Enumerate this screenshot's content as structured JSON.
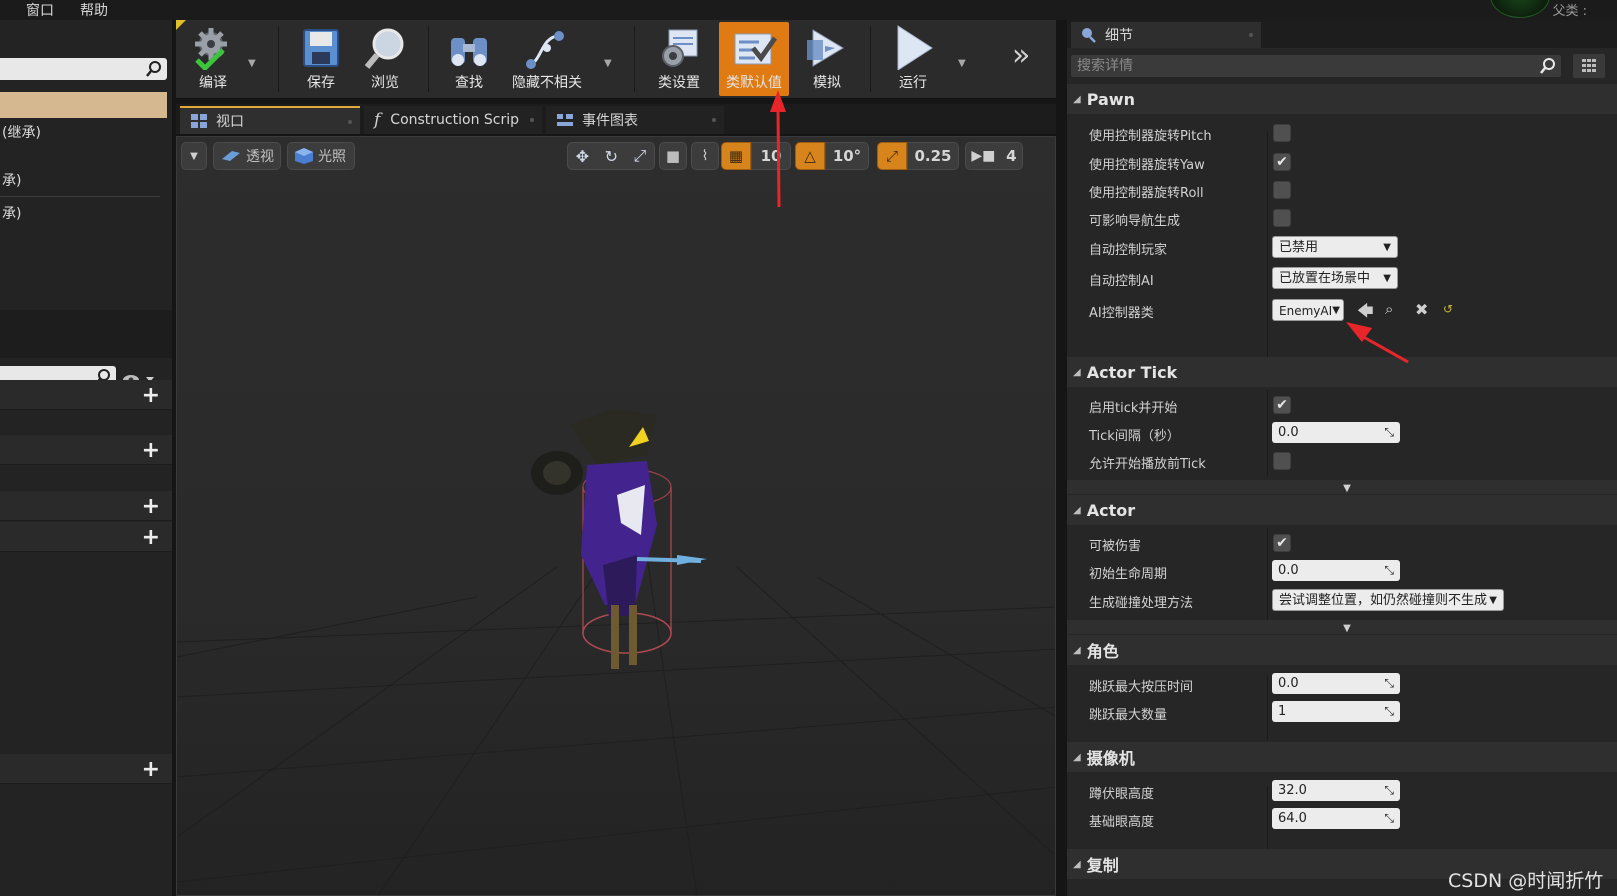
{
  "menubar": {
    "items": [
      "窗口",
      "帮助"
    ],
    "parent_class": "父类 :"
  },
  "left_panel": {
    "items": [
      "(继承)",
      "承)",
      "承)"
    ]
  },
  "toolbar": {
    "buttons": [
      {
        "label": "编译",
        "icon": "compile-gear-icon"
      },
      {
        "label": "保存",
        "icon": "save-disk-icon"
      },
      {
        "label": "浏览",
        "icon": "browse-magnifier-icon"
      },
      {
        "label": "查找",
        "icon": "find-binoculars-icon"
      },
      {
        "label": "隐藏不相关",
        "icon": "hide-unrelated-icon"
      },
      {
        "label": "类设置",
        "icon": "class-settings-icon"
      },
      {
        "label": "类默认值",
        "icon": "class-defaults-icon",
        "active": true
      },
      {
        "label": "模拟",
        "icon": "simulate-icon"
      },
      {
        "label": "运行",
        "icon": "play-icon"
      }
    ],
    "overflow": "»"
  },
  "tabs": [
    {
      "label": "视口",
      "icon": "viewport-grid-icon"
    },
    {
      "label": "Construction Scrip",
      "icon": "function-icon"
    },
    {
      "label": "事件图表",
      "icon": "event-graph-icon"
    }
  ],
  "viewport_toolbar": {
    "perspective": "透视",
    "lighting": "光照",
    "grid_snap": "10",
    "rotation_snap": "10°",
    "scale_snap": "0.25",
    "camera_speed": "4"
  },
  "details": {
    "tab_title": "细节",
    "search_placeholder": "搜索详情",
    "sections": {
      "pawn": {
        "title": "Pawn",
        "use_ctrl_pitch": "使用控制器旋转Pitch",
        "use_ctrl_yaw": "使用控制器旋转Yaw",
        "use_ctrl_roll": "使用控制器旋转Roll",
        "can_affect_nav": "可影响导航生成",
        "auto_possess_player": "自动控制玩家",
        "auto_possess_player_value": "已禁用",
        "auto_possess_ai": "自动控制AI",
        "auto_possess_ai_value": "已放置在场景中",
        "ai_controller_class": "AI控制器类",
        "ai_controller_class_value": "EnemyAI"
      },
      "actor_tick": {
        "title": "Actor Tick",
        "start_with_tick": "启用tick并开始",
        "tick_interval": "Tick间隔（秒）",
        "tick_interval_value": "0.0",
        "allow_tick_before_play": "允许开始播放前Tick"
      },
      "actor": {
        "title": "Actor",
        "can_be_damaged": "可被伤害",
        "initial_lifespan": "初始生命周期",
        "initial_lifespan_value": "0.0",
        "spawn_collision": "生成碰撞处理方法",
        "spawn_collision_value": "尝试调整位置，如仍然碰撞则不生成"
      },
      "character": {
        "title": "角色",
        "jump_max_hold": "跳跃最大按压时间",
        "jump_max_hold_value": "0.0",
        "jump_max_count": "跳跃最大数量",
        "jump_max_count_value": "1"
      },
      "camera": {
        "title": "摄像机",
        "crouched_eye": "蹲伏眼高度",
        "crouched_eye_value": "32.0",
        "base_eye": "基础眼高度",
        "base_eye_value": "64.0"
      },
      "replication": {
        "title": "复制"
      }
    }
  },
  "checkbox_states": {
    "use_ctrl_pitch": false,
    "use_ctrl_yaw": true,
    "use_ctrl_roll": false,
    "can_affect_nav": false,
    "start_with_tick": true,
    "allow_tick_before_play": false,
    "can_be_damaged": true
  },
  "colors": {
    "accent_orange": "#e07a12",
    "annotation_red": "#e8262a",
    "selection_tan": "#d5b790"
  },
  "watermark": "CSDN @时闻折竹"
}
